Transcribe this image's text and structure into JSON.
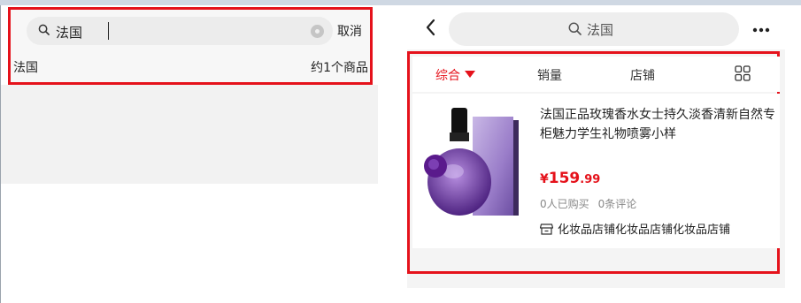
{
  "left_panel": {
    "search": {
      "query": "法国"
    },
    "cancel_label": "取消",
    "suggestion": {
      "text": "法国",
      "count": "约1个商品"
    }
  },
  "right_panel": {
    "search": {
      "query": "法国"
    },
    "filters": [
      {
        "label": "综合",
        "active": true
      },
      {
        "label": "销量"
      },
      {
        "label": "店铺"
      }
    ],
    "product": {
      "title": "法国正品玫瑰香水女士持久淡香清新自然专柜魅力学生礼物喷雾小样",
      "price": {
        "currency": "¥",
        "integer": "159",
        "decimal": ".99"
      },
      "sold": "0人已购买",
      "reviews": "0条评论",
      "shop": "化妆品店铺化妆品店铺化妆品店铺"
    }
  },
  "colors": {
    "accent": "#e5121b",
    "panel_bg": "#f4f4f4"
  },
  "icons": [
    "search-icon",
    "clear-icon",
    "back-icon",
    "more-icon",
    "dropdown-arrow-icon",
    "grid-view-icon",
    "shop-icon"
  ]
}
